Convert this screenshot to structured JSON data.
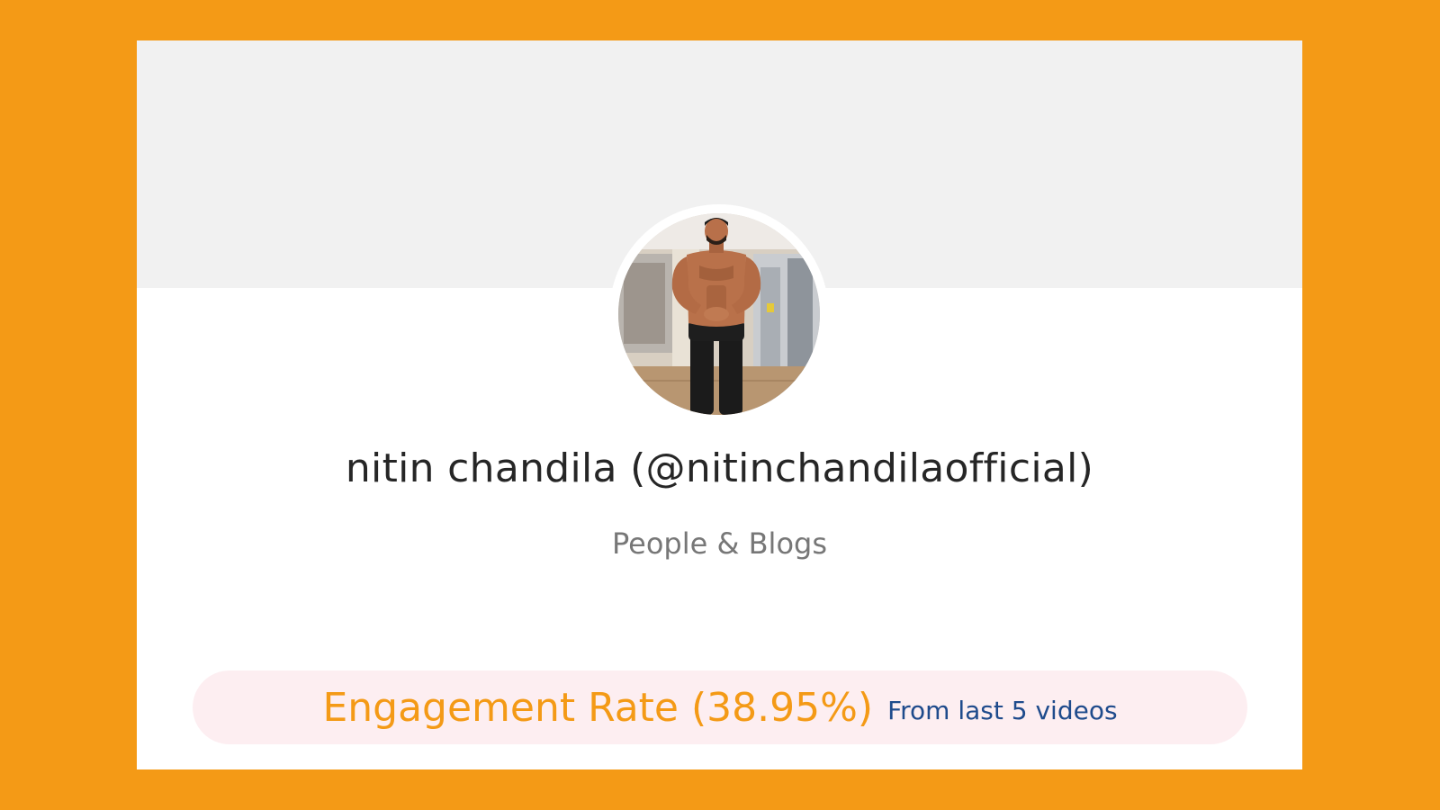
{
  "profile": {
    "display_name": "nitin chandila (@nitinchandilaofficial)",
    "category": "People & Blogs",
    "avatar": {
      "alt": "nitin chandila"
    }
  },
  "engagement": {
    "title": "Engagement Rate (38.95%)",
    "note": "From last 5 videos"
  },
  "colors": {
    "frame": "#f49a16",
    "banner": "#f1f1f1",
    "card": "#ffffff",
    "pill": "#fdeef1",
    "accent": "#f49a16",
    "note": "#1f4b8c",
    "name_text": "#262626",
    "category_text": "#777777"
  }
}
